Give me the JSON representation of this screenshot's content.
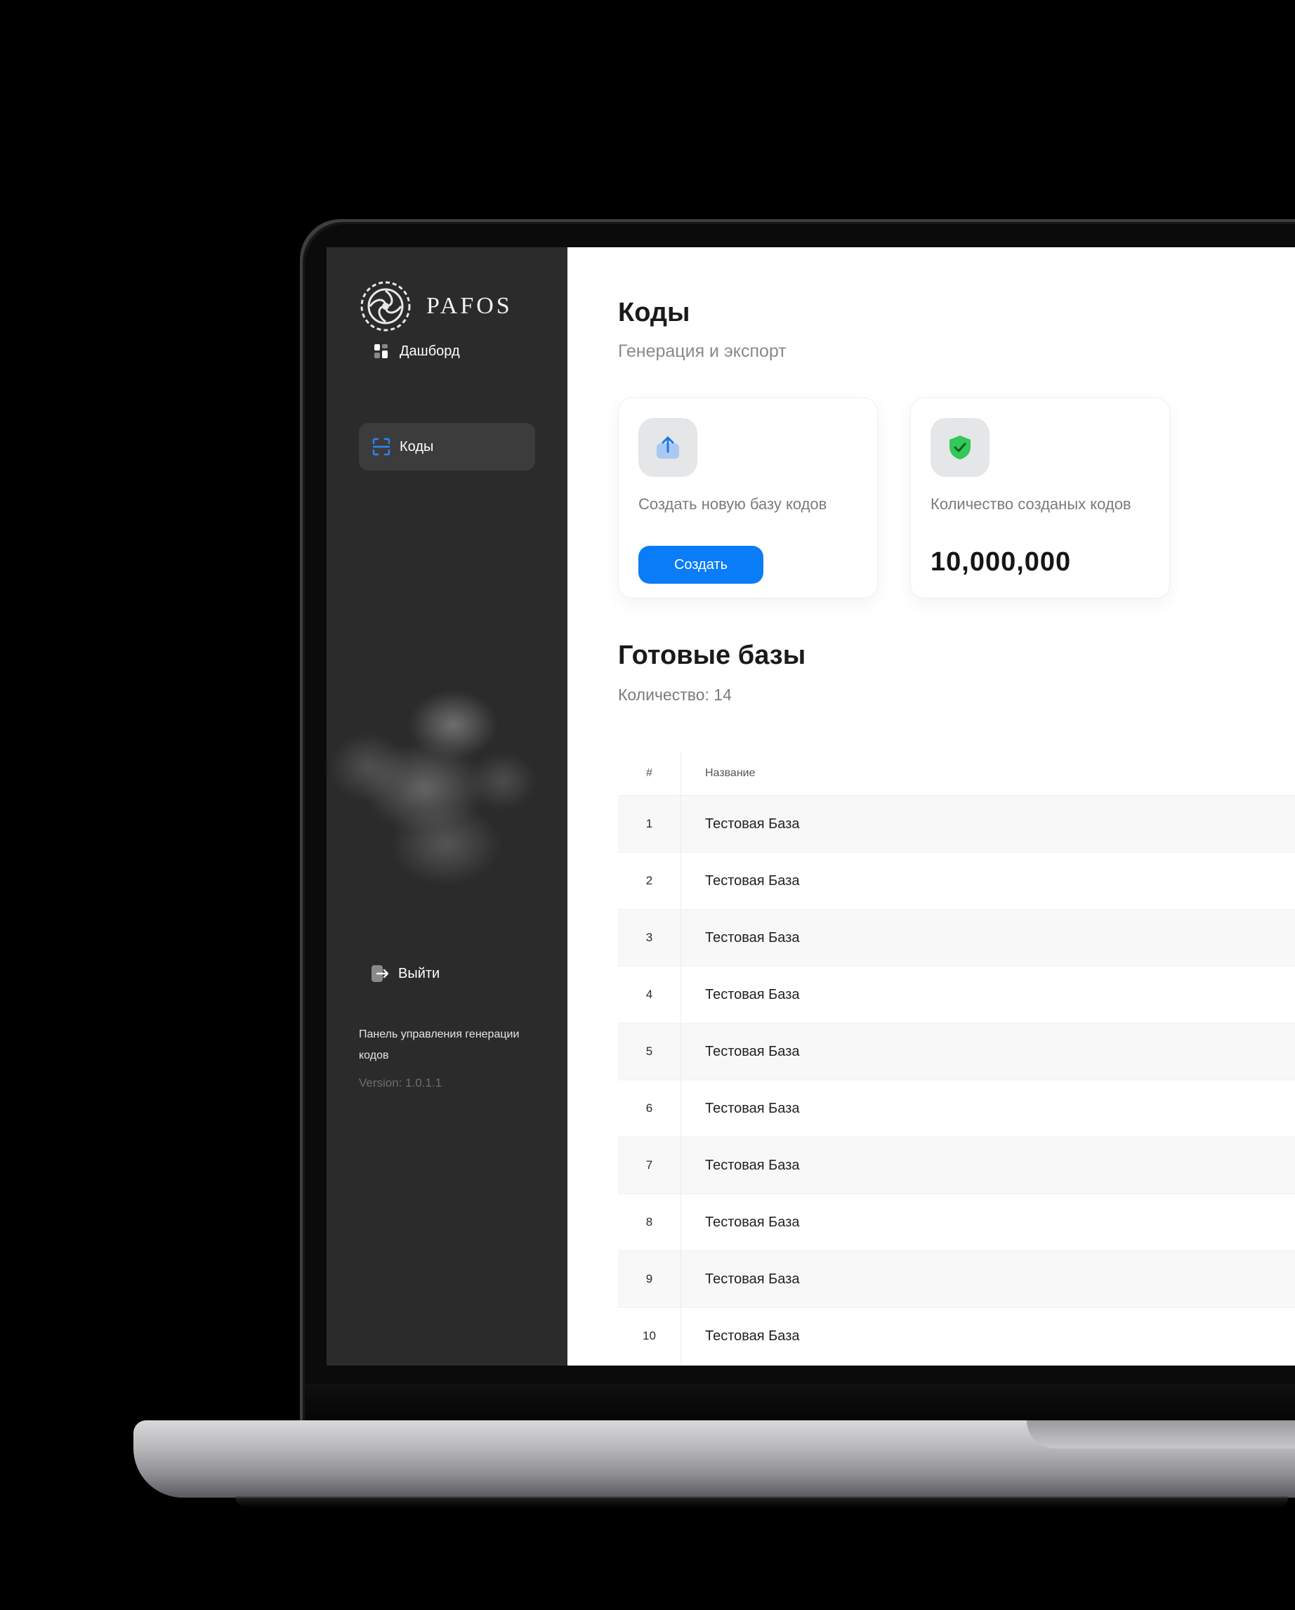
{
  "sidebar": {
    "brand": "PAFOS",
    "nav": [
      {
        "label": "Дашборд",
        "icon": "dashboard-icon"
      },
      {
        "label": "Коды",
        "icon": "scan-code-icon",
        "active": true
      }
    ],
    "logout_label": "Выйти",
    "footnote": "Панель управления генерации кодов",
    "version": "Version: 1.0.1.1"
  },
  "main": {
    "title": "Коды",
    "subtitle": "Генерация и экспорт",
    "create_card": {
      "label": "Создать новую базу кодов",
      "button": "Создать",
      "icon": "upload-icon"
    },
    "stats_card": {
      "label": "Количество созданых кодов",
      "value": "10,000,000",
      "icon": "shield-check-icon"
    },
    "ready_title": "Готовые базы",
    "ready_count": "Количество: 14",
    "table": {
      "columns": [
        "#",
        "Название"
      ],
      "rows": [
        [
          "1",
          "Тестовая База"
        ],
        [
          "2",
          "Тестовая База"
        ],
        [
          "3",
          "Тестовая База"
        ],
        [
          "4",
          "Тестовая База"
        ],
        [
          "5",
          "Тестовая База"
        ],
        [
          "6",
          "Тестовая База"
        ],
        [
          "7",
          "Тестовая База"
        ],
        [
          "8",
          "Тестовая База"
        ],
        [
          "9",
          "Тестовая База"
        ],
        [
          "10",
          "Тестовая База"
        ]
      ]
    }
  },
  "colors": {
    "accent": "#0a7cf7",
    "sidebar": "#2b2b2b",
    "success": "#34c759"
  }
}
